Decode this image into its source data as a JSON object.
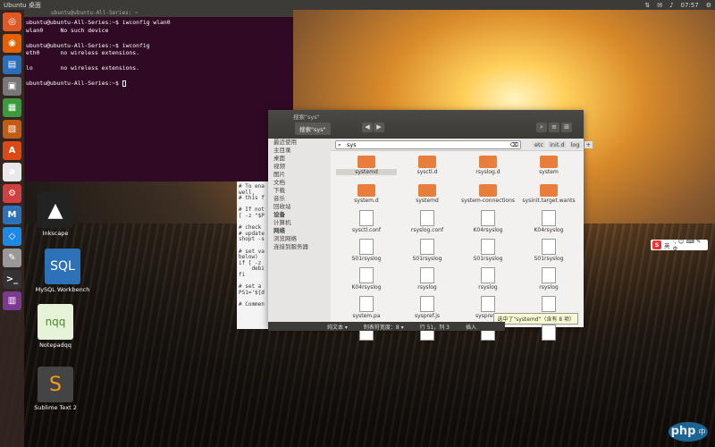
{
  "top_panel": {
    "title": "Ubuntu 桌面",
    "time": "07:57",
    "tray_icons": [
      "network-icon",
      "language-icon",
      "volume-icon",
      "settings-icon"
    ]
  },
  "launcher": {
    "items": [
      {
        "name": "ubuntu-logo-icon",
        "glyph": "◎",
        "color": "#e25822"
      },
      {
        "name": "firefox-icon",
        "glyph": "◉",
        "color": "#e66000"
      },
      {
        "name": "writer-icon",
        "glyph": "▤",
        "color": "#2a6ebb"
      },
      {
        "name": "files-icon",
        "glyph": "▣",
        "color": "#777"
      },
      {
        "name": "calc-icon",
        "glyph": "▦",
        "color": "#3c9a3c"
      },
      {
        "name": "impress-icon",
        "glyph": "▧",
        "color": "#c25b16"
      },
      {
        "name": "software-center-icon",
        "glyph": "A",
        "color": "#dd4814"
      },
      {
        "name": "amazon-icon",
        "glyph": "a",
        "color": "#e8e8e8"
      },
      {
        "name": "system-settings-icon",
        "glyph": "⚙",
        "color": "#d04040"
      },
      {
        "name": "mysql-workbench-icon",
        "glyph": "M",
        "color": "#2d72b8"
      },
      {
        "name": "vscode-icon",
        "glyph": "◇",
        "color": "#1e88e5"
      },
      {
        "name": "text-editor-icon",
        "glyph": "✎",
        "color": "#999"
      },
      {
        "name": "terminal-icon",
        "glyph": ">_",
        "color": "#333"
      },
      {
        "name": "app-icon",
        "glyph": "▥",
        "color": "#7b3a8f"
      }
    ]
  },
  "desktop": {
    "icons": [
      {
        "label": "Inkscape",
        "name": "inkscape-icon"
      },
      {
        "label": "MySQL Workbench",
        "name": "mysql-workbench-desktop-icon"
      },
      {
        "label": "Notepadqq",
        "name": "notepadqq-icon"
      },
      {
        "label": "Sublime Text 2",
        "name": "sublime-text-icon"
      }
    ]
  },
  "terminal": {
    "title": "ubuntu@ubuntu-All-Series: ~",
    "lines": "ubuntu@ubuntu-All-Series:~$ iwconfig wlan0\nwlan0     No such device\n\nubuntu@ubuntu-All-Series:~$ iwconfig\neth0      no wireless extensions.\n\nlo        no wireless extensions.\n\nubuntu@ubuntu-All-Series:~$ "
  },
  "editor": {
    "lines": "# To ena\nwell,\n# this f\n\n# If not\n[ -z \"$P\n\n# check\n# update\nshopt -s\n\n# set va\nbelow)\nif [ -z\n    debi\nfi\n\n# set a\nPS1='${d\n\n# Commen",
    "status": [
      "纯文本 ▾",
      "制表符宽度：8 ▾",
      "行 51，列 3",
      "插入"
    ]
  },
  "files": {
    "window_title": "搜索\"sys\"",
    "tab_label": "搜索\"sys\"",
    "search_value": "sys",
    "crumbs": [
      "etc",
      "init.d",
      "log"
    ],
    "sidebar": [
      {
        "label": "最近使用",
        "head": false
      },
      {
        "label": "主目录",
        "head": false
      },
      {
        "label": "桌面",
        "head": false
      },
      {
        "label": "视频",
        "head": false
      },
      {
        "label": "图片",
        "head": false
      },
      {
        "label": "文档",
        "head": false
      },
      {
        "label": "下载",
        "head": false
      },
      {
        "label": "音乐",
        "head": false
      },
      {
        "label": "回收站",
        "head": false
      },
      {
        "label": "设备",
        "head": true
      },
      {
        "label": "计算机",
        "head": false
      },
      {
        "label": "网络",
        "head": true
      },
      {
        "label": "浏览网络",
        "head": false
      },
      {
        "label": "连接到服务器",
        "head": false
      }
    ],
    "items": [
      {
        "label": "systemd",
        "type": "folder",
        "selected": true
      },
      {
        "label": "sysctl.d",
        "type": "folder"
      },
      {
        "label": "rsyslog.d",
        "type": "folder"
      },
      {
        "label": "system",
        "type": "folder"
      },
      {
        "label": "system.d",
        "type": "folder"
      },
      {
        "label": "systemd",
        "type": "folder"
      },
      {
        "label": "system-connections",
        "type": "folder"
      },
      {
        "label": "sysinit.target.wants",
        "type": "folder"
      },
      {
        "label": "sysctl.conf",
        "type": "doc"
      },
      {
        "label": "rsyslog.conf",
        "type": "doc"
      },
      {
        "label": "K04rsyslog",
        "type": "doc"
      },
      {
        "label": "K04rsyslog",
        "type": "doc"
      },
      {
        "label": "S01rsyslog",
        "type": "doc"
      },
      {
        "label": "S01rsyslog",
        "type": "doc"
      },
      {
        "label": "S01rsyslog",
        "type": "doc"
      },
      {
        "label": "S01rsyslog",
        "type": "doc"
      },
      {
        "label": "K04rsyslog",
        "type": "doc"
      },
      {
        "label": "rsyslog",
        "type": "doc"
      },
      {
        "label": "rsyslog",
        "type": "doc"
      },
      {
        "label": "rsyslog",
        "type": "doc"
      },
      {
        "label": "system.pa",
        "type": "doc"
      },
      {
        "label": "syspref.js",
        "type": "doc"
      },
      {
        "label": "syspref.js",
        "type": "doc"
      },
      {
        "label": "system.conf",
        "type": "doc"
      },
      {
        "label": "",
        "type": "doc"
      },
      {
        "label": "",
        "type": "doc"
      },
      {
        "label": "",
        "type": "doc"
      },
      {
        "label": "",
        "type": "doc"
      }
    ],
    "status": "选中了\"systemd\"（含有 8 项）"
  },
  "ime_bar": {
    "logo": "S",
    "label": "英",
    "extras": "·, ☺ ⌨ ✎ ⚙"
  },
  "watermark": {
    "brand": "php",
    "suffix": "中文网"
  }
}
